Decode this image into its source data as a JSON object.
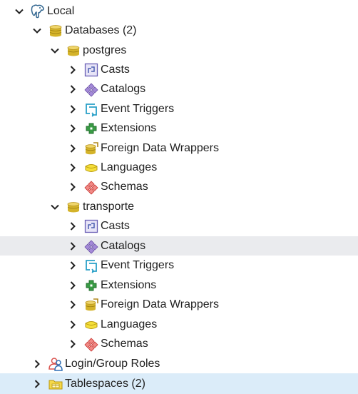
{
  "tree": {
    "server": {
      "label": "Local",
      "icon": "postgres-elephant-icon"
    },
    "databases": {
      "label": "Databases (2)",
      "icon": "databases-icon"
    },
    "postgres": {
      "label": "postgres",
      "icon": "database-icon",
      "children": [
        {
          "label": "Casts",
          "icon": "casts-icon"
        },
        {
          "label": "Catalogs",
          "icon": "catalogs-icon"
        },
        {
          "label": "Event Triggers",
          "icon": "event-triggers-icon"
        },
        {
          "label": "Extensions",
          "icon": "extensions-icon"
        },
        {
          "label": "Foreign Data Wrappers",
          "icon": "foreign-data-wrappers-icon"
        },
        {
          "label": "Languages",
          "icon": "languages-icon"
        },
        {
          "label": "Schemas",
          "icon": "schemas-icon"
        }
      ]
    },
    "transporte": {
      "label": "transporte",
      "icon": "database-icon",
      "children": [
        {
          "label": "Casts",
          "icon": "casts-icon"
        },
        {
          "label": "Catalogs",
          "icon": "catalogs-icon"
        },
        {
          "label": "Event Triggers",
          "icon": "event-triggers-icon"
        },
        {
          "label": "Extensions",
          "icon": "extensions-icon"
        },
        {
          "label": "Foreign Data Wrappers",
          "icon": "foreign-data-wrappers-icon"
        },
        {
          "label": "Languages",
          "icon": "languages-icon"
        },
        {
          "label": "Schemas",
          "icon": "schemas-icon"
        }
      ]
    },
    "login_roles": {
      "label": "Login/Group Roles",
      "icon": "login-group-roles-icon"
    },
    "tablespaces": {
      "label": "Tablespaces (2)",
      "icon": "tablespaces-icon"
    }
  },
  "colors": {
    "hover_row": "#eaebee",
    "selected_row": "#dbecf9",
    "db_gold": "#d4b32a",
    "schema_red": "#d9534f",
    "catalog_purple": "#7a5fb5",
    "trigger_cyan": "#2aa0c8",
    "extension_green": "#2f8f3a"
  }
}
